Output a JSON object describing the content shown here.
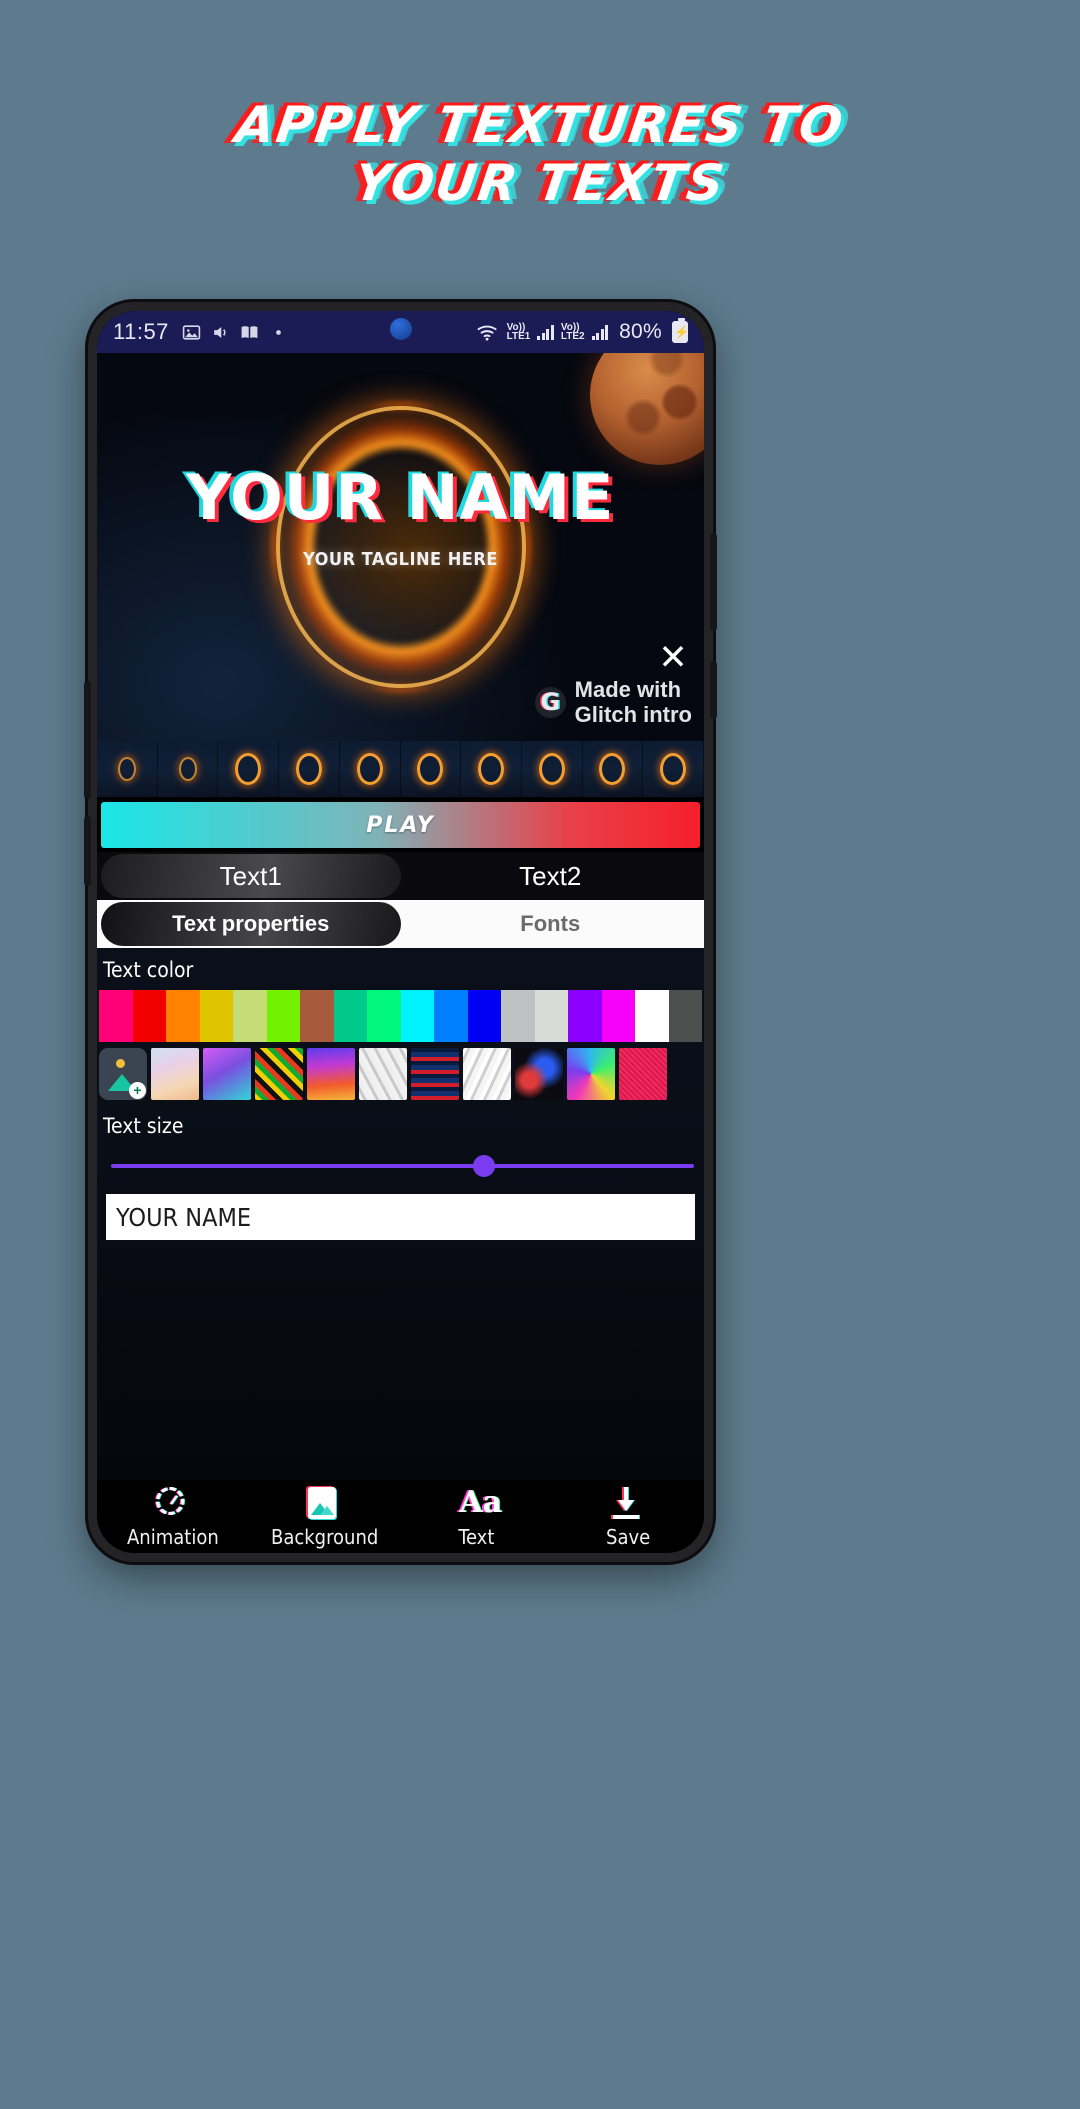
{
  "promo": {
    "line1": "APPLY TEXTURES TO",
    "line2": "YOUR TEXTS",
    "glitch_red": "#ff1a1a",
    "glitch_cyan": "#35e0e0",
    "background": "#5d7b8c"
  },
  "statusbar": {
    "time": "11:57",
    "icons": [
      "image-icon",
      "volume-icon",
      "book-icon",
      "dot-icon"
    ],
    "wifi": "wifi-icon",
    "sim1_volte": "Vo))",
    "sim1_label": "LTE1",
    "sim2_volte": "Vo))",
    "sim2_label": "LTE2",
    "battery_percent": "80%",
    "battery_state": "charging"
  },
  "preview": {
    "title": "YOUR NAME",
    "tagline": "YOUR TAGLINE HERE",
    "watermark_logo": "G",
    "watermark_line1": "Made with",
    "watermark_line2": "Glitch intro",
    "close_label": "✕"
  },
  "controls": {
    "play_label": "PLAY",
    "play_gradient_from": "#1ae7e7",
    "play_gradient_to": "#f51f2b",
    "text_tabs": [
      {
        "label": "Text1",
        "active": true
      },
      {
        "label": "Text2",
        "active": false
      }
    ],
    "property_tabs": [
      {
        "label": "Text properties",
        "active": true
      },
      {
        "label": "Fonts",
        "active": false
      }
    ]
  },
  "panel": {
    "text_color_label": "Text color",
    "colors": [
      "#ff0077",
      "#f20000",
      "#ff8200",
      "#dfc400",
      "#c4dd77",
      "#72f200",
      "#a85a3e",
      "#00c98a",
      "#00f77c",
      "#00f2ff",
      "#0080ff",
      "#0000f5",
      "#bfc2c2",
      "#d9dbd9",
      "#8b00ff",
      "#f700f7",
      "#ffffff",
      "#4d4f4f"
    ],
    "textures": [
      {
        "name": "add-image",
        "css": "add"
      },
      {
        "name": "pastel-marble",
        "css": "linear-gradient(160deg,#cfe3f2 0%,#e8d0e8 35%,#f5d7b5 70%,#f0b88a 100%)"
      },
      {
        "name": "purple-cyan-gradient",
        "css": "linear-gradient(150deg,#d65cf5 0%,#7a4fe0 45%,#2fd6d6 100%)"
      },
      {
        "name": "confetti-blocks",
        "css": "repeating-linear-gradient(45deg,#f2d000 0 5px,#11aa33 5px 10px,#e83a1e 10px 15px,#111 15px 20px)"
      },
      {
        "name": "sunset-gradient",
        "css": "linear-gradient(175deg,#5b3df0 0%,#c43ad0 35%,#f25c2b 70%,#f5b63c 100%)"
      },
      {
        "name": "crumpled-paper-grey",
        "css": "repeating-linear-gradient(62deg,#f2f2f2 0 4px,#c9c9c9 4px 7px,#efefef 7px 11px)"
      },
      {
        "name": "tartan-plaid",
        "css": "repeating-linear-gradient(0deg,#d21d2b 0 4px,#12306e 4px 9px,#0a1a3d 9px 13px),repeating-linear-gradient(90deg,rgba(210,29,43,0.55) 0 4px,rgba(18,48,110,0.55) 4px 9px)"
      },
      {
        "name": "white-crumple",
        "css": "repeating-linear-gradient(115deg,#ffffff 0 4px,#cfcfcf 4px 7px,#f5f5f5 7px 12px)"
      },
      {
        "name": "blue-red-smoke",
        "css": "radial-gradient(circle at 30% 62%,#e03a3a 0 16%,rgba(0,0,0,0) 40%),radial-gradient(circle at 62% 38%,#2a5cf0 0 20%,rgba(0,0,0,0) 48%),#0a0a10"
      },
      {
        "name": "rainbow-swirl",
        "css": "conic-gradient(from 210deg,#f23ab5,#7a3cf0,#2fb6f0,#3df06b,#f0d62f,#f23ab5)"
      },
      {
        "name": "pink-noise",
        "css": "repeating-linear-gradient(45deg,#f5295e 0 2px,#d41a4c 2px 4px)"
      }
    ],
    "text_size_label": "Text size",
    "text_size_percent": 64,
    "slider_color": "#7b3cf0",
    "text_input_value": "YOUR NAME"
  },
  "bottomnav": [
    {
      "label": "Animation",
      "icon": "animation-icon"
    },
    {
      "label": "Background",
      "icon": "background-image-icon"
    },
    {
      "label": "Text",
      "icon": "text-aa-icon"
    },
    {
      "label": "Save",
      "icon": "download-save-icon"
    }
  ],
  "androidnav": {
    "recents": "recents-icon",
    "home": "home-icon",
    "back": "back-icon"
  }
}
